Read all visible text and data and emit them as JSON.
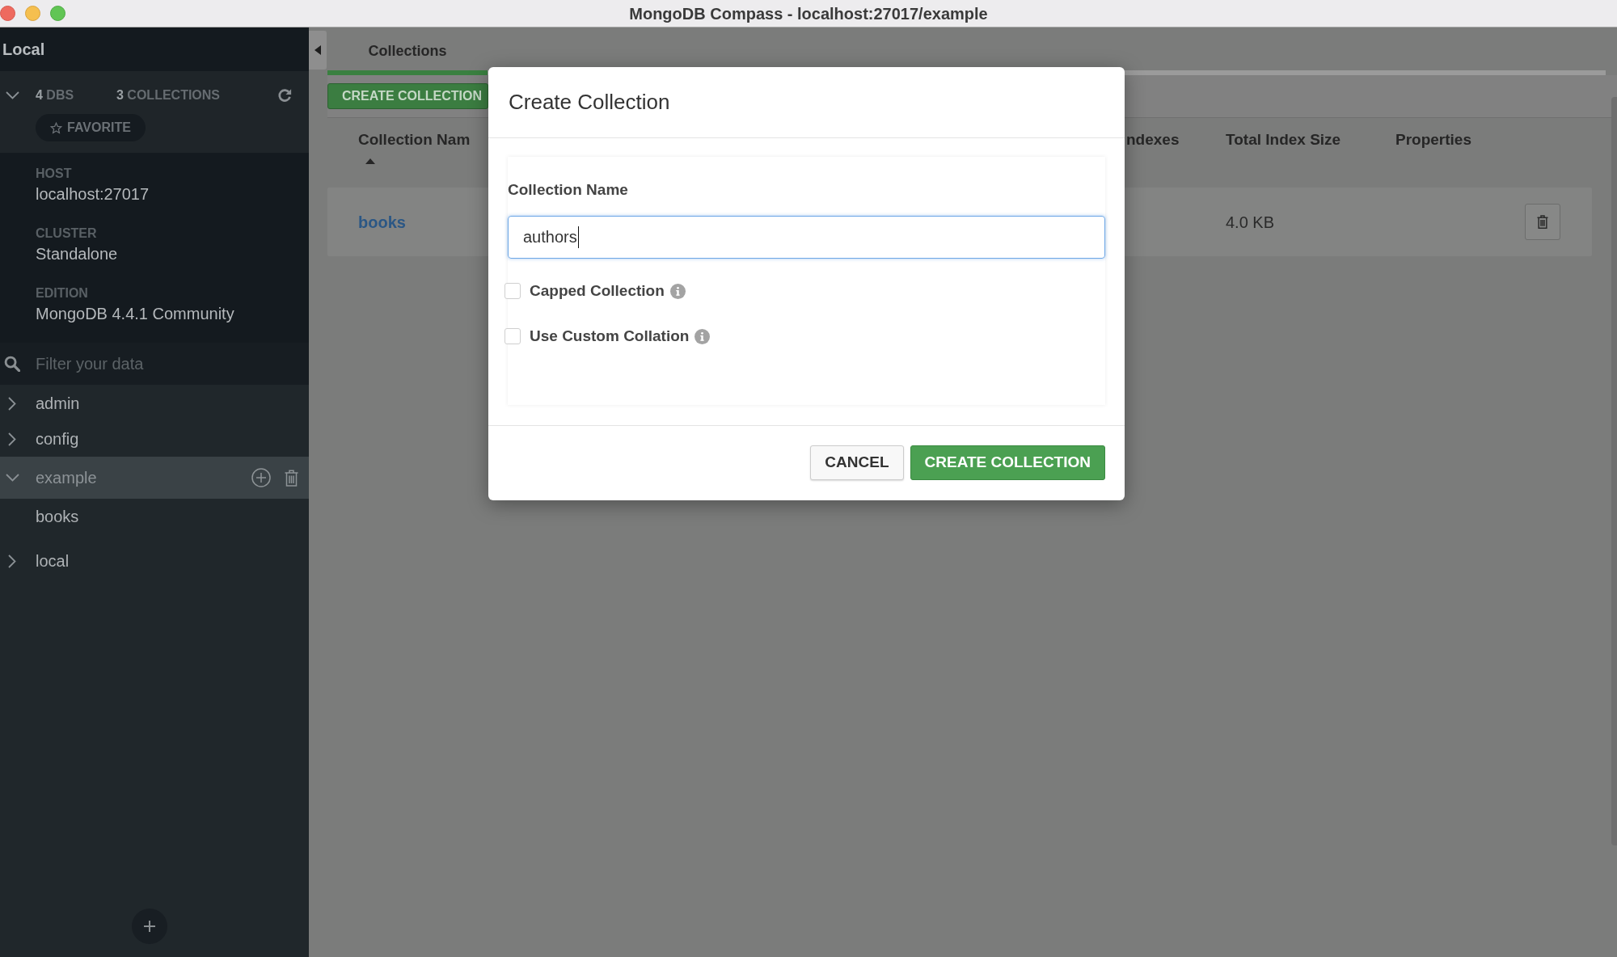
{
  "window": {
    "title": "MongoDB Compass - localhost:27017/example"
  },
  "sidebar": {
    "title": "Local",
    "summary": {
      "expanded": true,
      "stats": [
        {
          "count": "4",
          "label": "DBS"
        },
        {
          "count": "3",
          "label": "COLLECTIONS"
        }
      ],
      "favorite_button": "FAVORITE"
    },
    "instance": [
      {
        "label": "HOST",
        "value": "localhost:27017"
      },
      {
        "label": "CLUSTER",
        "value": "Standalone"
      },
      {
        "label": "EDITION",
        "value": "MongoDB 4.4.1 Community"
      }
    ],
    "filter": {
      "placeholder": "Filter your data"
    },
    "databases": [
      {
        "name": "admin",
        "expanded": false,
        "selected": false
      },
      {
        "name": "config",
        "expanded": false,
        "selected": false
      },
      {
        "name": "example",
        "expanded": true,
        "selected": true,
        "children": [
          {
            "name": "books",
            "selected": false
          }
        ]
      },
      {
        "name": "local",
        "expanded": false,
        "selected": false
      }
    ]
  },
  "main": {
    "tabs": [
      {
        "label": "Collections",
        "selected": true
      }
    ],
    "toolbar": {
      "create_button": "CREATE COLLECTION"
    },
    "table": {
      "columns": [
        {
          "label": "Collection Nam",
          "sorted": true
        },
        {
          "label": "ndexes",
          "sorted": false
        },
        {
          "label": "Total Index Size",
          "sorted": false
        },
        {
          "label": "Properties",
          "sorted": false
        }
      ],
      "rows": [
        {
          "collection_name": "books",
          "total_index_size": "4.0 KB"
        }
      ]
    }
  },
  "dialog": {
    "title": "Create Collection",
    "name_field": {
      "label": "Collection Name",
      "value": "authors",
      "focused": true
    },
    "options": [
      {
        "label": "Capped Collection",
        "checked": false
      },
      {
        "label": "Use Custom Collation",
        "checked": false
      }
    ],
    "buttons": [
      {
        "label": "CANCEL",
        "kind": "secondary"
      },
      {
        "label": "CREATE COLLECTION",
        "kind": "primary"
      }
    ]
  }
}
